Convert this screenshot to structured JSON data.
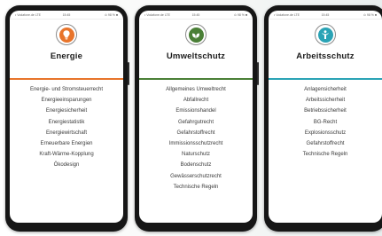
{
  "cards": [
    {
      "title": "Energie",
      "icon": "lightbulb-icon",
      "accent_color": "#e8742b",
      "status": {
        "left": "• Vodafone.de  LTE",
        "center": "15:45",
        "right": "⊙ 98 % ■"
      },
      "items": [
        "Energie- und Stromsteuerrecht",
        "Energieeinsparungen",
        "Energiesicherheit",
        "Energiestatistik",
        "Energiewirtschaft",
        "Erneuerbare Energien",
        "Kraft-Wärme-Kopplung",
        "Ökodesign"
      ]
    },
    {
      "title": "Umweltschutz",
      "icon": "leaves-icon",
      "accent_color": "#4a7f36",
      "status": {
        "left": "• Vodafone.de  LTE",
        "center": "15:45",
        "right": "⊙ 98 % ■"
      },
      "items": [
        "Allgemeines Umweltrecht",
        "Abfallrecht",
        "Emissionshandel",
        "Gefahrgutrecht",
        "Gefahrstoffrecht",
        "Immissionsschutzrecht",
        "Naturschutz",
        "Bodenschutz",
        "Gewässerschutzrecht",
        "Technische Regeln"
      ]
    },
    {
      "title": "Arbeitsschutz",
      "icon": "worker-icon",
      "accent_color": "#2aa3b5",
      "status": {
        "left": "• Vodafone.de  LTE",
        "center": "15:45",
        "right": "⊙ 98 % ■"
      },
      "items": [
        "Anlagensicherheit",
        "Arbeitssicherheit",
        "Betriebssicherheit",
        "BG-Recht",
        "Explosionsschutz",
        "Gefahrstoffrecht",
        "Technische Regeln"
      ]
    }
  ]
}
